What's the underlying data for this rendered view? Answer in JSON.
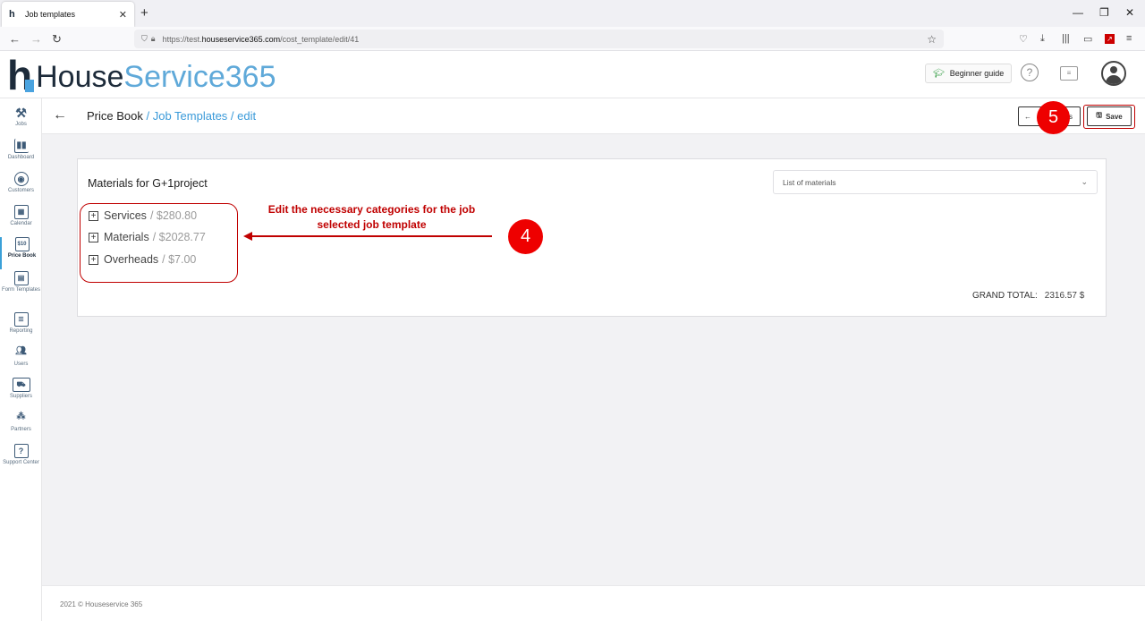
{
  "browser": {
    "tab_title": "Job templates",
    "url_prefix": "https://test.",
    "url_host": "houseservice365.com",
    "url_path": "/cost_template/edit/41"
  },
  "header": {
    "logo_part1": "House",
    "logo_part2": "Service365",
    "beginner_guide": "Beginner guide"
  },
  "sidebar": {
    "items": [
      {
        "label": "Jobs",
        "icon": "tools-icon"
      },
      {
        "label": "Dashboard",
        "icon": "chart-icon"
      },
      {
        "label": "Customers",
        "icon": "customers-icon"
      },
      {
        "label": "Calendar",
        "icon": "calendar-icon"
      },
      {
        "label": "Price Book",
        "icon": "price-book-icon",
        "glyph": "$10"
      },
      {
        "label": "Form Templates",
        "icon": "form-icon"
      },
      {
        "label": "Reporting",
        "icon": "reporting-icon"
      },
      {
        "label": "Users",
        "icon": "users-icon"
      },
      {
        "label": "Suppliers",
        "icon": "truck-icon"
      },
      {
        "label": "Partners",
        "icon": "partners-icon"
      },
      {
        "label": "Support Center",
        "icon": "support-icon",
        "glyph": "?"
      }
    ]
  },
  "breadcrumb": {
    "root": "Price Book",
    "rest": " / Job Templates / edit"
  },
  "actions": {
    "back_label": "ts",
    "save_label": "Save"
  },
  "card": {
    "title": "Materials for G+1project",
    "select_value": "List of materials",
    "categories": [
      {
        "name": "Services",
        "price": "/ $280.80"
      },
      {
        "name": "Materials",
        "price": "/ $2028.77"
      },
      {
        "name": "Overheads",
        "price": "/ $7.00"
      }
    ],
    "grand_total_label": "GRAND TOTAL:",
    "grand_total_value": "2316.57 $"
  },
  "annotations": {
    "step4": "4",
    "step5": "5",
    "note_line1": "Edit the necessary categories for the job",
    "note_line2": "selected job template"
  },
  "footer": {
    "text": "2021 © Houseservice 365"
  }
}
